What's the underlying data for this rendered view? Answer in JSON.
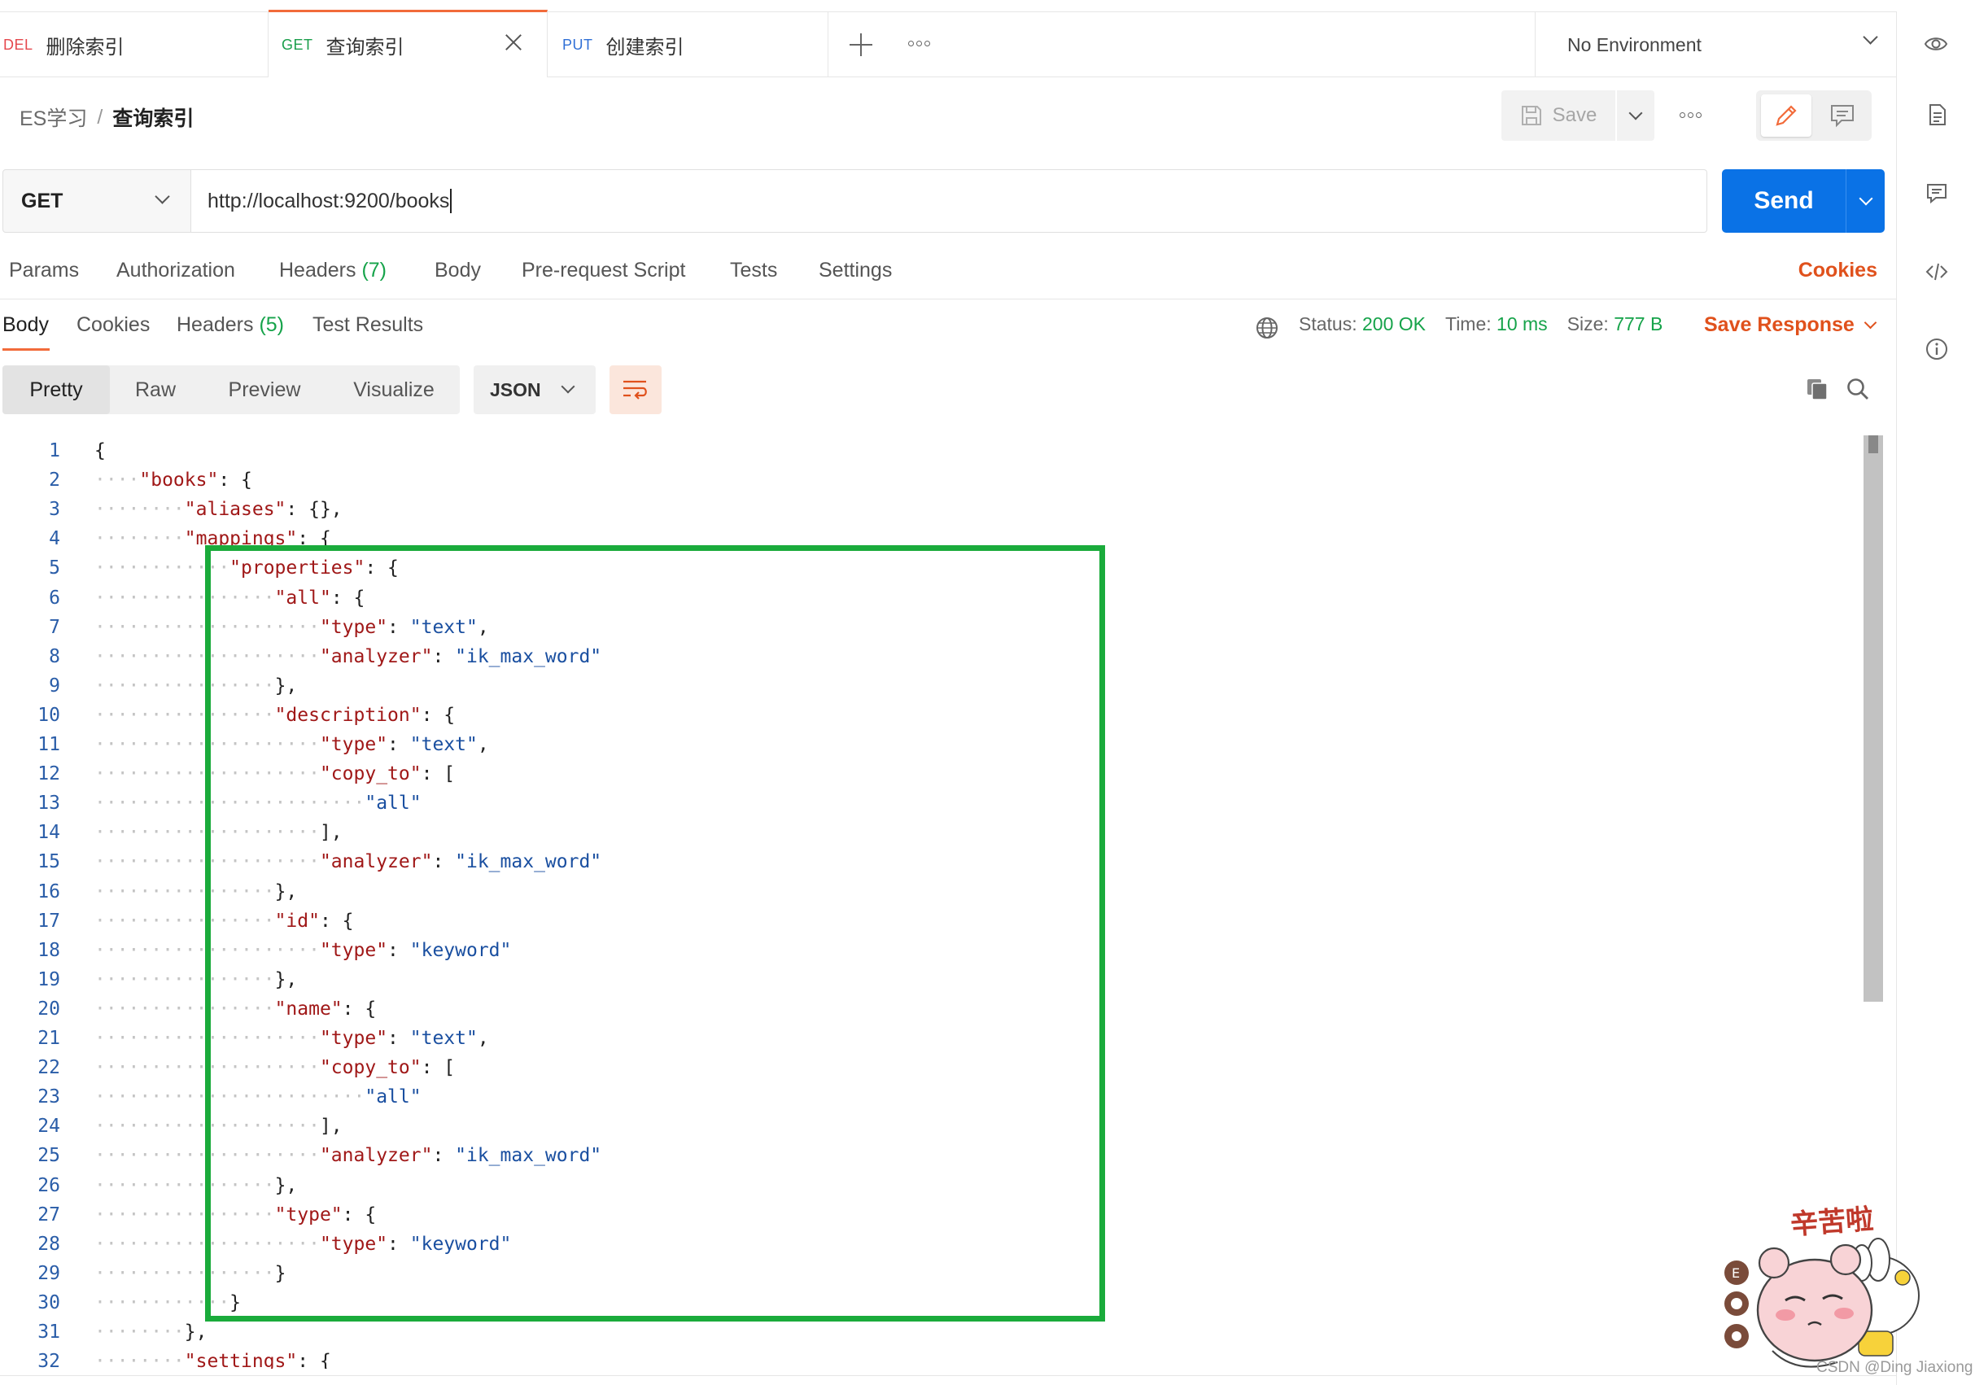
{
  "tabs": [
    {
      "method": "DEL",
      "name": "删除索引",
      "color": "#e5484d"
    },
    {
      "method": "GET",
      "name": "查询索引",
      "color": "#1a9e4b",
      "active": true
    },
    {
      "method": "PUT",
      "name": "创建索引",
      "color": "#2f6fd6"
    }
  ],
  "environment": "No Environment",
  "breadcrumb": {
    "collection": "ES学习",
    "separator": "/",
    "request": "查询索引"
  },
  "toolbar": {
    "save_label": "Save"
  },
  "request": {
    "method": "GET",
    "url": "http://localhost:9200/books",
    "send_label": "Send"
  },
  "request_tabs": {
    "params": "Params",
    "authorization": "Authorization",
    "headers": "Headers",
    "headers_count": "(7)",
    "body": "Body",
    "prerequest": "Pre-request Script",
    "tests": "Tests",
    "settings": "Settings",
    "cookies": "Cookies"
  },
  "response_tabs": {
    "body": "Body",
    "cookies": "Cookies",
    "headers": "Headers",
    "headers_count": "(5)",
    "test_results": "Test Results"
  },
  "status": {
    "status_label": "Status:",
    "status_value": "200 OK",
    "time_label": "Time:",
    "time_value": "10 ms",
    "size_label": "Size:",
    "size_value": "777 B"
  },
  "save_response": "Save Response",
  "view_modes": [
    "Pretty",
    "Raw",
    "Preview",
    "Visualize"
  ],
  "format": "JSON",
  "code_lines": [
    {
      "n": "1",
      "d": 0,
      "t": [
        [
          "p",
          "{"
        ]
      ]
    },
    {
      "n": "2",
      "d": 1,
      "t": [
        [
          "k",
          "\"books\""
        ],
        [
          "p",
          ": {"
        ]
      ]
    },
    {
      "n": "3",
      "d": 2,
      "t": [
        [
          "k",
          "\"aliases\""
        ],
        [
          "p",
          ": {},"
        ]
      ]
    },
    {
      "n": "4",
      "d": 2,
      "t": [
        [
          "k",
          "\"mappings\""
        ],
        [
          "p",
          ": {"
        ]
      ]
    },
    {
      "n": "5",
      "d": 3,
      "t": [
        [
          "k",
          "\"properties\""
        ],
        [
          "p",
          ": {"
        ]
      ]
    },
    {
      "n": "6",
      "d": 4,
      "t": [
        [
          "k",
          "\"all\""
        ],
        [
          "p",
          ": {"
        ]
      ]
    },
    {
      "n": "7",
      "d": 5,
      "t": [
        [
          "k",
          "\"type\""
        ],
        [
          "p",
          ": "
        ],
        [
          "s",
          "\"text\""
        ],
        [
          "p",
          ","
        ]
      ]
    },
    {
      "n": "8",
      "d": 5,
      "t": [
        [
          "k",
          "\"analyzer\""
        ],
        [
          "p",
          ": "
        ],
        [
          "s",
          "\"ik_max_word\""
        ]
      ]
    },
    {
      "n": "9",
      "d": 4,
      "t": [
        [
          "p",
          "},"
        ]
      ]
    },
    {
      "n": "10",
      "d": 4,
      "t": [
        [
          "k",
          "\"description\""
        ],
        [
          "p",
          ": {"
        ]
      ]
    },
    {
      "n": "11",
      "d": 5,
      "t": [
        [
          "k",
          "\"type\""
        ],
        [
          "p",
          ": "
        ],
        [
          "s",
          "\"text\""
        ],
        [
          "p",
          ","
        ]
      ]
    },
    {
      "n": "12",
      "d": 5,
      "t": [
        [
          "k",
          "\"copy_to\""
        ],
        [
          "p",
          ": ["
        ]
      ]
    },
    {
      "n": "13",
      "d": 6,
      "t": [
        [
          "s",
          "\"all\""
        ]
      ]
    },
    {
      "n": "14",
      "d": 5,
      "t": [
        [
          "p",
          "],"
        ]
      ]
    },
    {
      "n": "15",
      "d": 5,
      "t": [
        [
          "k",
          "\"analyzer\""
        ],
        [
          "p",
          ": "
        ],
        [
          "s",
          "\"ik_max_word\""
        ]
      ]
    },
    {
      "n": "16",
      "d": 4,
      "t": [
        [
          "p",
          "},"
        ]
      ]
    },
    {
      "n": "17",
      "d": 4,
      "t": [
        [
          "k",
          "\"id\""
        ],
        [
          "p",
          ": {"
        ]
      ]
    },
    {
      "n": "18",
      "d": 5,
      "t": [
        [
          "k",
          "\"type\""
        ],
        [
          "p",
          ": "
        ],
        [
          "s",
          "\"keyword\""
        ]
      ]
    },
    {
      "n": "19",
      "d": 4,
      "t": [
        [
          "p",
          "},"
        ]
      ]
    },
    {
      "n": "20",
      "d": 4,
      "t": [
        [
          "k",
          "\"name\""
        ],
        [
          "p",
          ": {"
        ]
      ]
    },
    {
      "n": "21",
      "d": 5,
      "t": [
        [
          "k",
          "\"type\""
        ],
        [
          "p",
          ": "
        ],
        [
          "s",
          "\"text\""
        ],
        [
          "p",
          ","
        ]
      ]
    },
    {
      "n": "22",
      "d": 5,
      "t": [
        [
          "k",
          "\"copy_to\""
        ],
        [
          "p",
          ": ["
        ]
      ]
    },
    {
      "n": "23",
      "d": 6,
      "t": [
        [
          "s",
          "\"all\""
        ]
      ]
    },
    {
      "n": "24",
      "d": 5,
      "t": [
        [
          "p",
          "],"
        ]
      ]
    },
    {
      "n": "25",
      "d": 5,
      "t": [
        [
          "k",
          "\"analyzer\""
        ],
        [
          "p",
          ": "
        ],
        [
          "s",
          "\"ik_max_word\""
        ]
      ]
    },
    {
      "n": "26",
      "d": 4,
      "t": [
        [
          "p",
          "},"
        ]
      ]
    },
    {
      "n": "27",
      "d": 4,
      "t": [
        [
          "k",
          "\"type\""
        ],
        [
          "p",
          ": {"
        ]
      ]
    },
    {
      "n": "28",
      "d": 5,
      "t": [
        [
          "k",
          "\"type\""
        ],
        [
          "p",
          ": "
        ],
        [
          "s",
          "\"keyword\""
        ]
      ]
    },
    {
      "n": "29",
      "d": 4,
      "t": [
        [
          "p",
          "}"
        ]
      ]
    },
    {
      "n": "30",
      "d": 3,
      "t": [
        [
          "p",
          "}"
        ]
      ]
    },
    {
      "n": "31",
      "d": 2,
      "t": [
        [
          "p",
          "},"
        ]
      ]
    },
    {
      "n": "32",
      "d": 2,
      "t": [
        [
          "k",
          "\"settings\""
        ],
        [
          "p",
          ": {"
        ]
      ]
    }
  ],
  "sticker_text": "辛苦啦",
  "watermark": "CSDN @Ding Jiaxiong",
  "colors": {
    "accent_orange": "#f26b3a",
    "send_blue": "#0a72e6",
    "status_green": "#16a34a",
    "highlight_green": "#1aab3b",
    "json_key": "#a01818",
    "json_string": "#1a4fa0"
  }
}
